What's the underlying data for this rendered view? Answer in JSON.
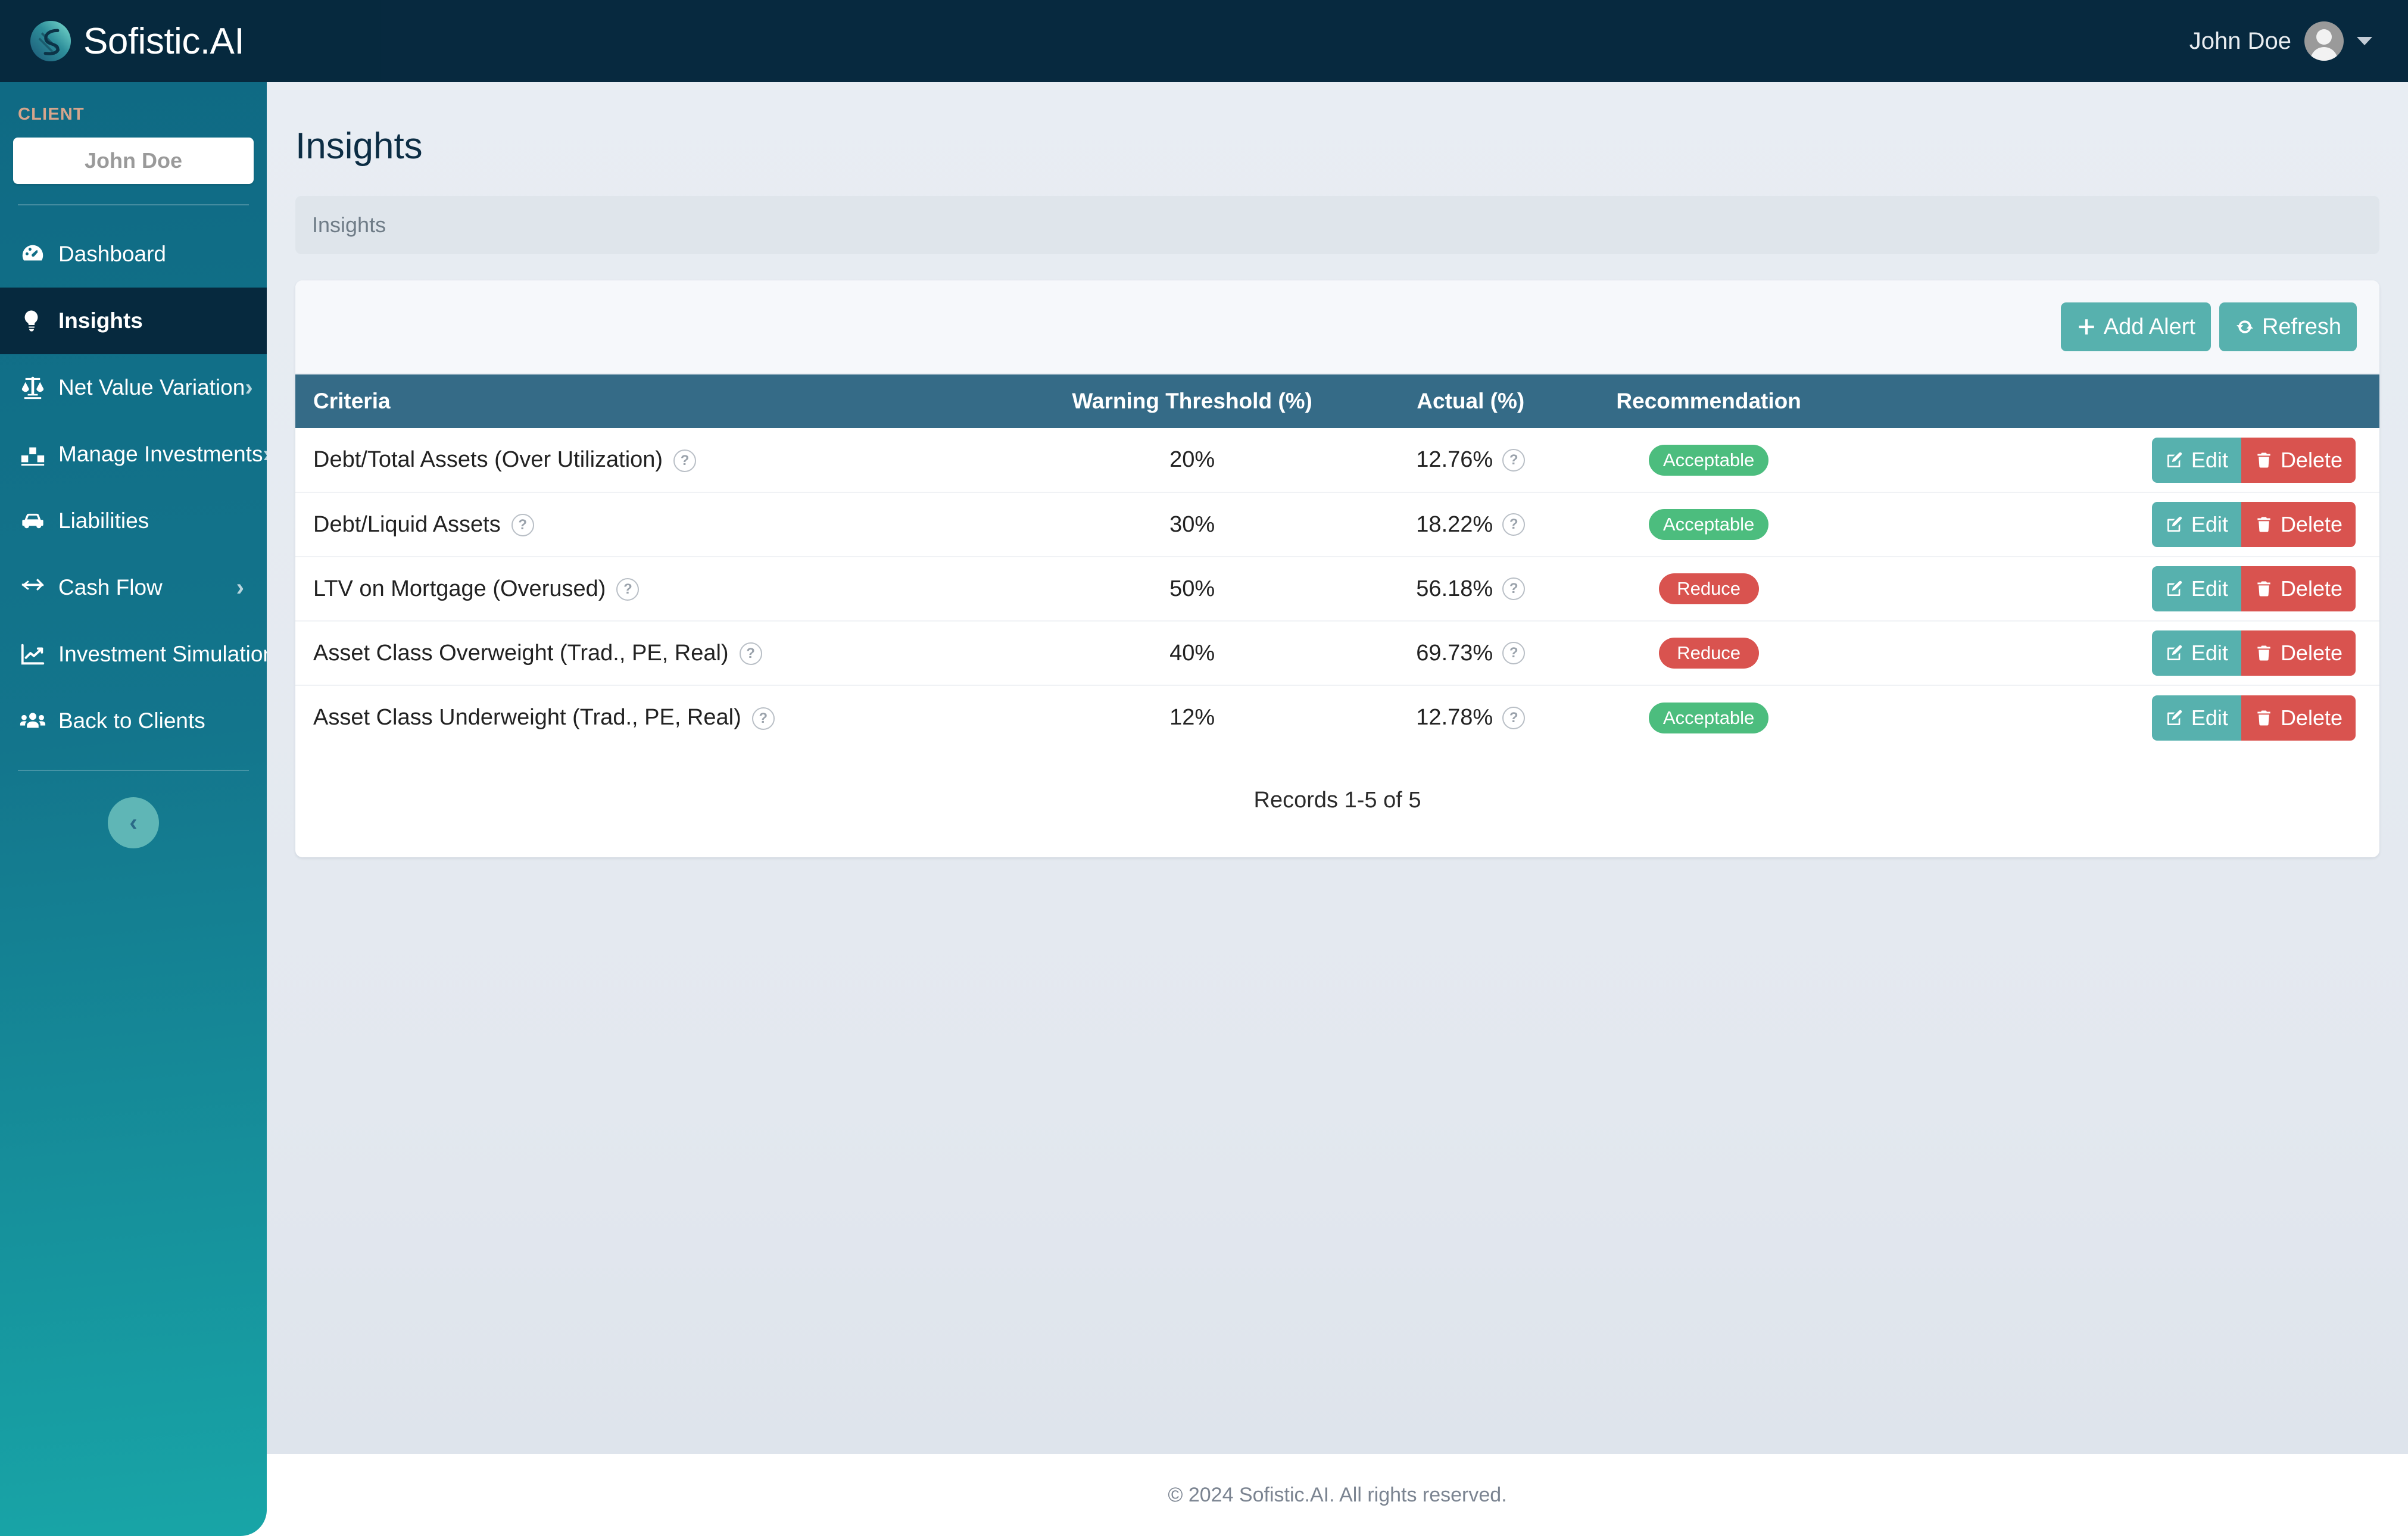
{
  "brand": {
    "name": "Sofistic.AI",
    "logo_icon": "sofistic-swirl-logo"
  },
  "navbar": {
    "user_name": "John Doe",
    "avatar_icon": "user-avatar-icon",
    "caret_icon": "chevron-down-icon"
  },
  "sidebar": {
    "client_label": "CLIENT",
    "client_name": "John Doe",
    "collapse_icon": "chevron-left-icon",
    "items": [
      {
        "label": "Dashboard",
        "icon": "dashboard-gauge-icon",
        "active": false,
        "has_chevron": false
      },
      {
        "label": "Insights",
        "icon": "lightbulb-icon",
        "active": true,
        "has_chevron": false
      },
      {
        "label": "Net Value Variation",
        "icon": "balance-scale-icon",
        "active": false,
        "has_chevron": true
      },
      {
        "label": "Manage Investments",
        "icon": "bar-chart-boxes-icon",
        "active": false,
        "has_chevron": true
      },
      {
        "label": "Liabilities",
        "icon": "car-icon",
        "active": false,
        "has_chevron": false
      },
      {
        "label": "Cash Flow",
        "icon": "exchange-arrows-icon",
        "active": false,
        "has_chevron": true
      },
      {
        "label": "Investment Simulation",
        "icon": "line-chart-icon",
        "active": false,
        "has_chevron": true
      },
      {
        "label": "Back to Clients",
        "icon": "users-group-icon",
        "active": false,
        "has_chevron": false
      }
    ]
  },
  "page": {
    "title": "Insights",
    "breadcrumb": "Insights"
  },
  "toolbar": {
    "add_alert_label": "Add Alert",
    "add_alert_icon": "plus-icon",
    "refresh_label": "Refresh",
    "refresh_icon": "refresh-icon"
  },
  "table": {
    "columns": [
      "Criteria",
      "Warning Threshold (%)",
      "Actual (%)",
      "Recommendation",
      ""
    ],
    "help_icon": "question-circle-icon",
    "edit_label": "Edit",
    "edit_icon": "pencil-square-icon",
    "delete_label": "Delete",
    "delete_icon": "trash-icon",
    "rows": [
      {
        "criteria": "Debt/Total Assets (Over Utilization)",
        "threshold": "20%",
        "actual": "12.76%",
        "recommendation": "Acceptable",
        "status": "ok"
      },
      {
        "criteria": "Debt/Liquid Assets",
        "threshold": "30%",
        "actual": "18.22%",
        "recommendation": "Acceptable",
        "status": "ok"
      },
      {
        "criteria": "LTV on Mortgage (Overused)",
        "threshold": "50%",
        "actual": "56.18%",
        "recommendation": "Reduce",
        "status": "warn"
      },
      {
        "criteria": "Asset Class Overweight (Trad., PE, Real)",
        "threshold": "40%",
        "actual": "69.73%",
        "recommendation": "Reduce",
        "status": "warn"
      },
      {
        "criteria": "Asset Class Underweight (Trad., PE, Real)",
        "threshold": "12%",
        "actual": "12.78%",
        "recommendation": "Acceptable",
        "status": "ok"
      }
    ],
    "records_text": "Records 1-5 of 5"
  },
  "footer": {
    "text": "© 2024 Sofistic.AI. All rights reserved."
  },
  "colors": {
    "navbar_bg": "#07293f",
    "sidebar_top": "#0f6a84",
    "sidebar_bottom": "#18a5a7",
    "active_item_bg": "#06293e",
    "table_header_bg": "#356b87",
    "teal_button": "#57b1ae",
    "danger": "#d9534f",
    "success": "#4cbd7e",
    "client_label": "#d6a58c"
  }
}
